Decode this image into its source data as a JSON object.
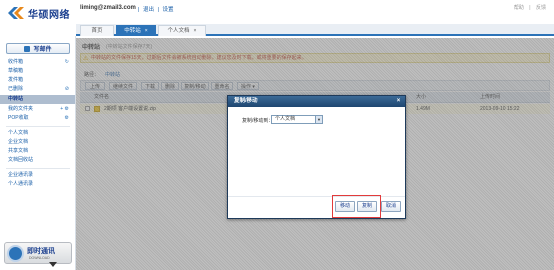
{
  "header": {
    "logo_text": "华硕网络",
    "user_email": "liming@zmail3.com",
    "links": [
      "|",
      "退出",
      "|",
      "设置"
    ],
    "top_right": [
      "帮助",
      "|",
      "反馈"
    ]
  },
  "tabs": [
    {
      "label": "首页"
    },
    {
      "label": "中转站",
      "close": "×"
    },
    {
      "label": "个人文档",
      "close": "×"
    }
  ],
  "sidebar": {
    "compose_label": "写邮件",
    "items": [
      {
        "label": "收件箱",
        "icon": "↻"
      },
      {
        "label": "草稿箱"
      },
      {
        "label": "发件箱"
      },
      {
        "label": "已删除",
        "icon": "⊘"
      },
      {
        "label": "中转站"
      },
      {
        "label": "我的文件夹",
        "icon": "+ ⚙"
      },
      {
        "label": "POP收取",
        "icon": "⚙"
      }
    ],
    "docs": [
      "个人文档",
      "企业文档",
      "共享文档",
      "文档回收站"
    ],
    "contacts": [
      "企业通讯录",
      "个人通讯录"
    ],
    "im": {
      "title": "即时通讯",
      "subtitle": "DOWNLOAD"
    }
  },
  "main": {
    "title": "中转站",
    "subtitle": "(中转站文件保存7天)",
    "warning": "中转站的文件保存15天，过期后文件会被系统自动删除，建议您及时下载，或将重要的保存起来。",
    "path_label": "路径：",
    "path_link": "中转站",
    "toolbar": [
      "上传",
      "继续文件",
      "下载",
      "删除",
      "复制/移动",
      "重命名",
      "操作 ▾"
    ],
    "columns": [
      "文件名",
      "大小",
      "上传时间"
    ],
    "rows": [
      {
        "name": "2期项 客户端设置说.zip",
        "size": "1.49M",
        "time": "2013-09-10 15:22"
      }
    ]
  },
  "dialog": {
    "title": "复制/移动",
    "close": "×",
    "label": "复制/移动到：",
    "select_value": "个人文档",
    "buttons": {
      "move": "移动",
      "copy": "复制",
      "cancel": "取消"
    }
  }
}
